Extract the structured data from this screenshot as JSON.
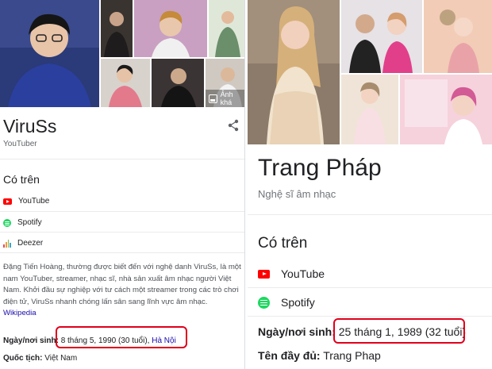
{
  "colors": {
    "highlight_box": "#e0001b",
    "link": "#1a0dab",
    "youtube_red": "#ff0000",
    "spotify_green": "#1ed760"
  },
  "left_panel": {
    "images_more_label": "Ảnh khá",
    "name": "ViruSs",
    "subtitle": "YouTuber",
    "available_on_title": "Có trên",
    "platforms": [
      {
        "label": "YouTube",
        "icon": "youtube-icon"
      },
      {
        "label": "Spotify",
        "icon": "spotify-icon"
      },
      {
        "label": "Deezer",
        "icon": "deezer-icon"
      }
    ],
    "description": "Đặng Tiến Hoàng, thường được biết đến với nghệ danh ViruSs, là một nam YouTuber, streamer, nhạc sĩ, nhà sản xuất âm nhạc người Việt Nam. Khởi đầu sự nghiệp với tư cách một streamer trong các trò chơi điện tử, ViruSs nhanh chóng lấn sân sang lĩnh vực âm nhạc.",
    "description_link": "Wikipedia",
    "birth_label": "Ngày/nơi sinh:",
    "birth_value": "8 tháng 5, 1990 (30 tuổi),",
    "birth_place": "Hà Nội",
    "nationality_label": "Quốc tịch:",
    "nationality_value": "Việt Nam"
  },
  "right_panel": {
    "name": "Trang Pháp",
    "subtitle": "Nghệ sĩ âm nhạc",
    "available_on_title": "Có trên",
    "platforms": [
      {
        "label": "YouTube",
        "icon": "youtube-icon"
      },
      {
        "label": "Spotify",
        "icon": "spotify-icon"
      }
    ],
    "birth_label": "Ngày/nơi sinh:",
    "birth_value": "25 tháng 1, 1989 (32 tuổi)",
    "fullname_label": "Tên đầy đủ:",
    "fullname_value": "Trang Phap"
  }
}
